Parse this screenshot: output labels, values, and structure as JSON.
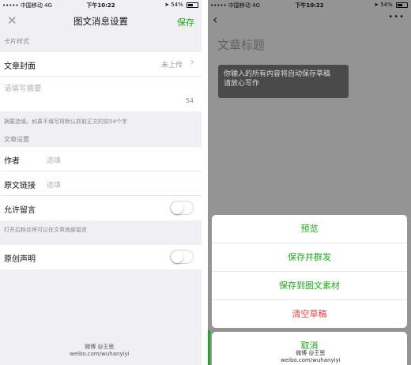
{
  "left": {
    "status": {
      "carrier": "••••• 中国移动 4G",
      "time": "下午10:22",
      "battery": "54%"
    },
    "nav": {
      "close": "✕",
      "title": "图文消息设置",
      "save": "保存"
    },
    "card_section": "卡片样式",
    "cover": {
      "label": "文章封面",
      "value": "未上传",
      "chevron": "›"
    },
    "summary": {
      "placeholder": "请填写摘要",
      "count": "54"
    },
    "summary_hint": "摘要选填。如果不填写将默认抓取正文的前54个字",
    "article_section": "文章设置",
    "author": {
      "label": "作者",
      "placeholder": "选填"
    },
    "source": {
      "label": "原文链接",
      "placeholder": "选填"
    },
    "comments": {
      "label": "允许留言",
      "on": false
    },
    "comments_hint": "打开后粉丝将可以在文章底部留言",
    "original": {
      "label": "原创声明",
      "on": false
    },
    "watermark": [
      "微博 @王思",
      "weibo.com/wuhanyiyi"
    ]
  },
  "right": {
    "status": {
      "carrier": "••••• 中国移动 4G",
      "time": "下午10:22",
      "battery": "54%"
    },
    "back": "‹",
    "more": "•••",
    "title_placeholder": "文章标题",
    "toast": [
      "你输入的所有内容将自动保存草稿",
      "请放心写作"
    ],
    "actions": [
      "预览",
      "保存并群发",
      "保存到图文素材",
      "清空草稿"
    ],
    "cancel": "取消",
    "watermark": [
      "微博 @王思",
      "weibo.com/wuhanyiyi"
    ]
  },
  "colors": {
    "accent": "#1aad19",
    "danger": "#e64340",
    "background": "#efeff4"
  }
}
